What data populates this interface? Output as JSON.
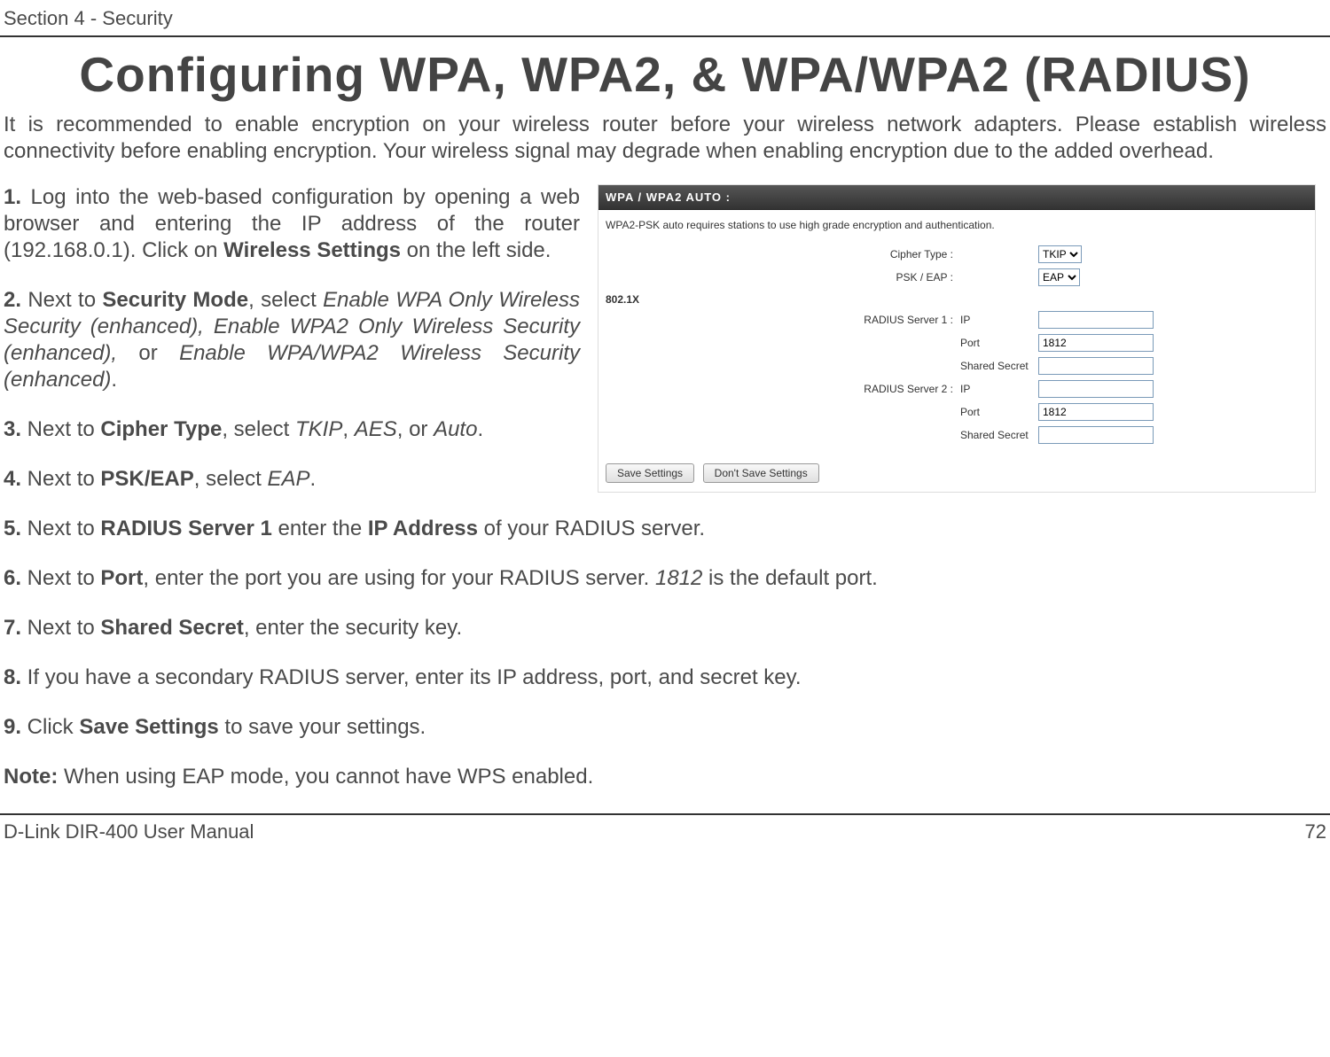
{
  "header": {
    "section": "Section 4 - Security"
  },
  "title": "Configuring WPA, WPA2, & WPA/WPA2 (RADIUS)",
  "intro": "It is recommended to enable encryption on your wireless router before your wireless network adapters. Please establish wireless connectivity before enabling encryption. Your wireless signal may degrade when enabling encryption due to the added overhead.",
  "steps": {
    "s1": {
      "num": "1.",
      "t1": " Log into the web-based configuration by opening a web browser and entering the IP address of the router (192.168.0.1).  Click on ",
      "b1": "Wireless Settings",
      "t2": " on the left side."
    },
    "s2": {
      "num": "2.",
      "t1": " Next to ",
      "b1": "Security Mode",
      "t2": ", select ",
      "i1": "Enable WPA Only Wireless Security (enhanced), Enable WPA2 Only Wireless Security (enhanced), ",
      "t3": "or ",
      "i2": "Enable WPA/WPA2 Wireless Security (enhanced)",
      "t4": "."
    },
    "s3": {
      "num": "3.",
      "t1": " Next to ",
      "b1": "Cipher Type",
      "t2": ", select ",
      "i1": "TKIP",
      "t3": ", ",
      "i2": "AES",
      "t4": ", or ",
      "i3": "Auto",
      "t5": "."
    },
    "s4": {
      "num": "4.",
      "t1": " Next to ",
      "b1": "PSK/EAP",
      "t2": ", select ",
      "i1": "EAP",
      "t3": "."
    },
    "s5": {
      "num": "5.",
      "t1": " Next to ",
      "b1": "RADIUS Server 1",
      "t2": " enter the ",
      "b2": "IP Address",
      "t3": " of your RADIUS server."
    },
    "s6": {
      "num": "6.",
      "t1": " Next to ",
      "b1": "Port",
      "t2": ", enter the port you are using for your RADIUS server. ",
      "i1": "1812",
      "t3": " is the default port."
    },
    "s7": {
      "num": "7.",
      "t1": " Next to ",
      "b1": "Shared Secret",
      "t2": ", enter the security key."
    },
    "s8": {
      "num": "8.",
      "t1": " If you have a secondary RADIUS server, enter its IP address, port, and secret key."
    },
    "s9": {
      "num": "9.",
      "t1": " Click ",
      "b1": "Save Settings",
      "t2": " to save your settings."
    },
    "note": {
      "b1": "Note:",
      "t1": " When using EAP mode, you cannot have WPS enabled."
    }
  },
  "screenshot": {
    "panel_title": "WPA / WPA2 AUTO :",
    "panel_desc": "WPA2-PSK auto requires stations to use high grade encryption and authentication.",
    "labels": {
      "cipher": "Cipher Type :",
      "psk_eap": "PSK / EAP :",
      "sect": "802.1X",
      "r1": "RADIUS Server 1 :",
      "r2": "RADIUS Server 2 :",
      "ip": "IP",
      "port": "Port",
      "secret": "Shared Secret"
    },
    "values": {
      "cipher_option": "TKIP",
      "psk_eap_option": "EAP",
      "r1_ip": "",
      "r1_port": "1812",
      "r1_secret": "",
      "r2_ip": "",
      "r2_port": "1812",
      "r2_secret": ""
    },
    "buttons": {
      "save": "Save Settings",
      "dont": "Don't Save Settings"
    }
  },
  "footer": {
    "left": "D-Link DIR-400 User Manual",
    "right": "72"
  }
}
